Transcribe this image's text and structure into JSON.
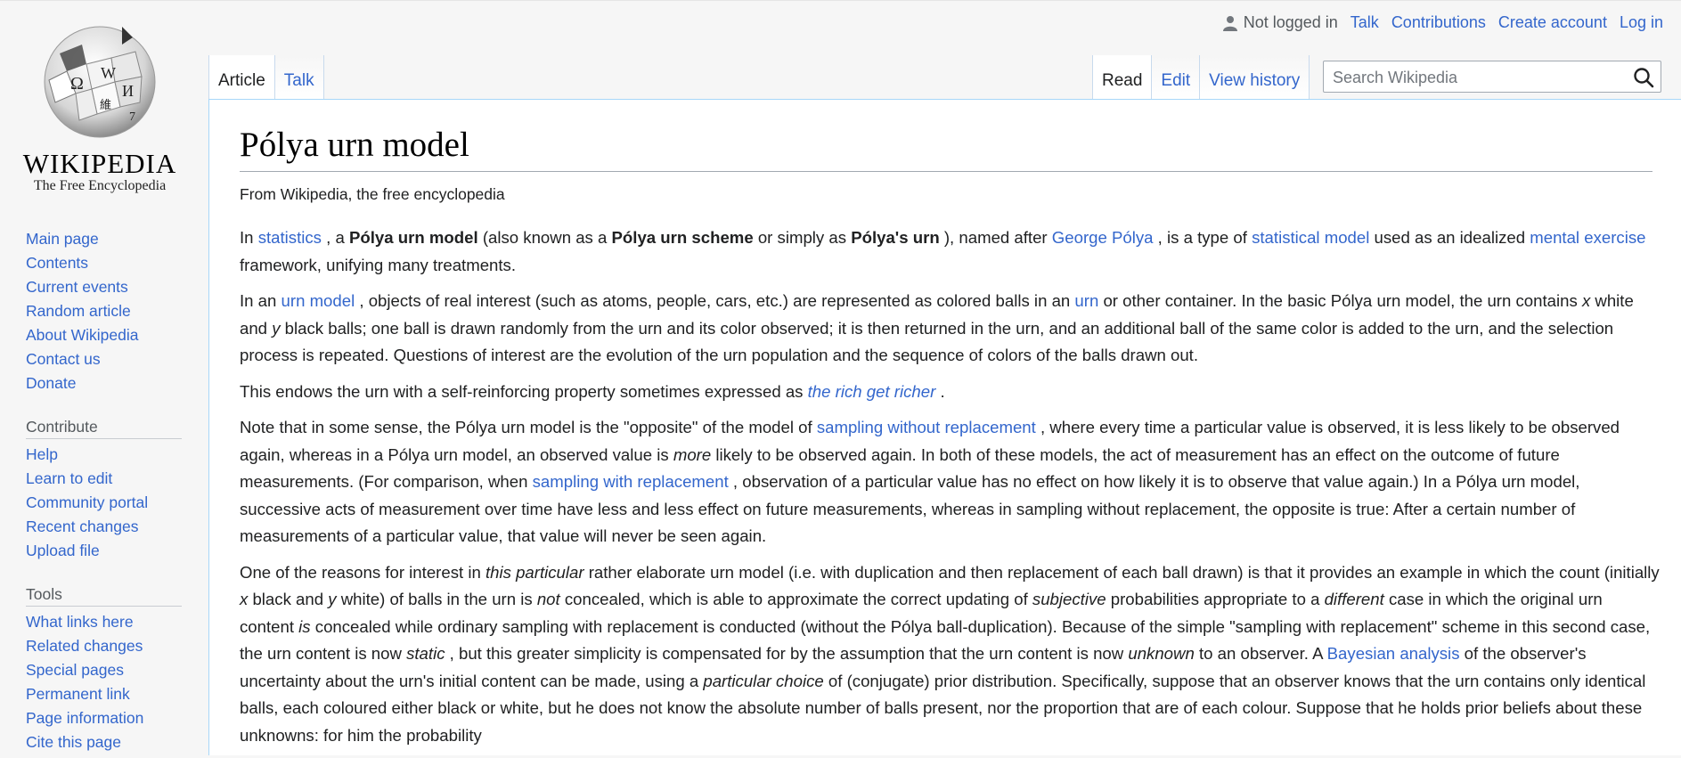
{
  "logo": {
    "wordmark": "Wikipedia",
    "tagline": "The Free Encyclopedia"
  },
  "personal": {
    "status": "Not logged in",
    "talk": "Talk",
    "contributions": "Contributions",
    "create_account": "Create account",
    "login": "Log in"
  },
  "tabs": {
    "article": "Article",
    "talk": "Talk",
    "read": "Read",
    "edit": "Edit",
    "history": "View history"
  },
  "search": {
    "placeholder": "Search Wikipedia"
  },
  "sidebar": {
    "nav": [
      "Main page",
      "Contents",
      "Current events",
      "Random article",
      "About Wikipedia",
      "Contact us",
      "Donate"
    ],
    "contribute_heading": "Contribute",
    "contribute": [
      "Help",
      "Learn to edit",
      "Community portal",
      "Recent changes",
      "Upload file"
    ],
    "tools_heading": "Tools",
    "tools": [
      "What links here",
      "Related changes",
      "Special pages",
      "Permanent link",
      "Page information",
      "Cite this page"
    ]
  },
  "article": {
    "title": "Pólya urn model",
    "tagline": "From Wikipedia, the free encyclopedia",
    "p1": {
      "t1": "In ",
      "l1": "statistics",
      "t2": " , a ",
      "b1": "Pólya urn model",
      "t3": " (also known as a ",
      "b2": "Pólya urn scheme",
      "t4": " or simply as ",
      "b3": "Pólya's urn",
      "t5": " ), named after ",
      "l2": "George Pólya",
      "t6": " , is a type of ",
      "l3": "statistical model",
      "t7": " used as an idealized ",
      "l4": "mental exercise",
      "t8": " framework, unifying many treatments."
    },
    "p2": {
      "t1": "In an ",
      "l1": "urn model",
      "t2": " , objects of real interest (such as atoms, people, cars, etc.) are represented as colored balls in an ",
      "l2": "urn",
      "t3": " or other container. In the basic Pólya urn model, the urn contains ",
      "i1": "x",
      "t4": " white and ",
      "i2": "y",
      "t5": " black balls; one ball is drawn randomly from the urn and its color observed; it is then returned in the urn, and an additional ball of the same color is added to the urn, and the selection process is repeated. Questions of interest are the evolution of the urn population and the sequence of colors of the balls drawn out."
    },
    "p3": {
      "t1": "This endows the urn with a self-reinforcing property sometimes expressed as ",
      "l1": "the rich get richer",
      "t2": " ."
    },
    "p4": {
      "t1": "Note that in some sense, the Pólya urn model is the \"opposite\" of the model of ",
      "l1": "sampling without replacement",
      "t2": " , where every time a particular value is observed, it is less likely to be observed again, whereas in a Pólya urn model, an observed value is ",
      "i1": "more",
      "t3": " likely to be observed again. In both of these models, the act of measurement has an effect on the outcome of future measurements. (For comparison, when ",
      "l2": "sampling with replacement",
      "t4": " , observation of a particular value has no effect on how likely it is to observe that value again.) In a Pólya urn model, successive acts of measurement over time have less and less effect on future measurements, whereas in sampling without replacement, the opposite is true: After a certain number of measurements of a particular value, that value will never be seen again."
    },
    "p5": {
      "t1": "One of the reasons for interest in ",
      "i1": "this particular",
      "t2": " rather elaborate urn model (i.e. with duplication and then replacement of each ball drawn) is that it provides an example in which the count (initially ",
      "i2": "x",
      "t3": " black and ",
      "i3": "y",
      "t4": " white) of balls in the urn is ",
      "i4": "not",
      "t5": " concealed, which is able to approximate the correct updating of ",
      "i5": "subjective",
      "t6": " probabilities appropriate to a ",
      "i6": "different",
      "t7": " case in which the original urn content ",
      "i7": "is",
      "t8": " concealed while ordinary sampling with replacement is conducted (without the Pólya ball-duplication). Because of the simple \"sampling with replacement\" scheme in this second case, the urn content is now ",
      "i8": "static",
      "t9": " , but this greater simplicity is compensated for by the assumption that the urn content is now ",
      "i9": "unknown",
      "t10": " to an observer. A ",
      "l1": "Bayesian analysis",
      "t11": " of the observer's uncertainty about the urn's initial content can be made, using a ",
      "i10": "particular choice",
      "t12": " of (conjugate) prior distribution. Specifically, suppose that an observer knows that the urn contains only identical balls, each coloured either black or white, but he does not know the absolute number of balls present, nor the proportion that are of each colour. Suppose that he holds prior beliefs about these unknowns: for him the probability"
    }
  },
  "colors": {
    "link": "#3366cc",
    "border": "#a7d7f9",
    "text": "#202122"
  },
  "icons": [
    "wikipedia-globe-icon",
    "user-icon",
    "search-icon"
  ]
}
